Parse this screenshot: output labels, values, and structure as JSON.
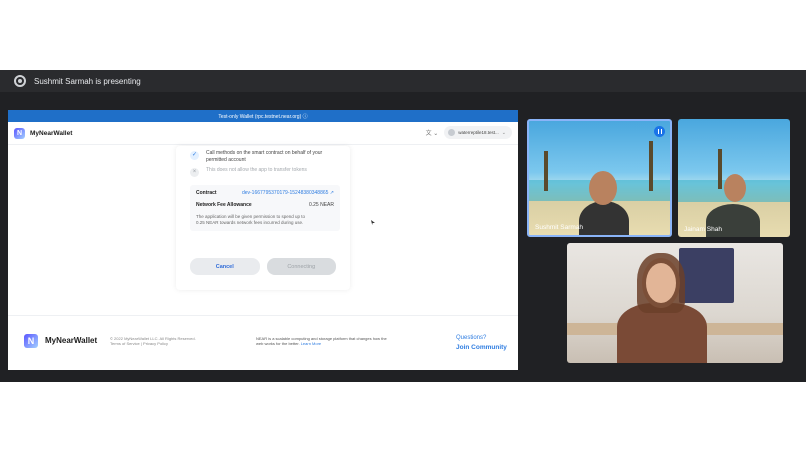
{
  "meet": {
    "presenting_label": "Sushmit Sarmah is presenting",
    "participants": [
      {
        "name": "Sushmit Sarmah",
        "speaking": true
      },
      {
        "name": "Jainam Shah",
        "speaking": false
      },
      {
        "name": "",
        "speaking": false
      }
    ]
  },
  "wallet": {
    "banner": "Test-only Wallet (rpc.testnet.near.org) ⓘ",
    "brand": "MyNearWallet",
    "language_icon": "translate-icon",
    "account": "waterreptile18.test...",
    "permissions": [
      {
        "text": "Call methods on the smart contract on behalf of your permitted account",
        "allowed": true
      },
      {
        "text": "This does not allow the app to transfer tokens",
        "allowed": false
      }
    ],
    "contract_label": "Contract",
    "contract_value": "dev-1667795370179-15248380348865 ↗",
    "fee_label": "Network Fee Allowance",
    "fee_value": "0.25 NEAR",
    "fee_note_1": "The application will be given permission to spend up to",
    "fee_note_2": "0.25 NEAR towards network fees incurred during use.",
    "cancel": "Cancel",
    "connect": "Connecting",
    "footer": {
      "brand": "MyNearWallet",
      "copyright": "© 2022 MyNearWallet LLC. All Rights Reserved.",
      "links": "Terms of Service | Privacy Policy",
      "desc": "NEAR is a scalable computing and storage platform that changes how the",
      "desc2": "web works for the better.",
      "learn_more": "Learn More",
      "questions": "Questions?",
      "join": "Join Community"
    }
  },
  "colors": {
    "accent": "#1f6fc8",
    "link": "#2f7de1",
    "meet_bg": "#202124"
  }
}
